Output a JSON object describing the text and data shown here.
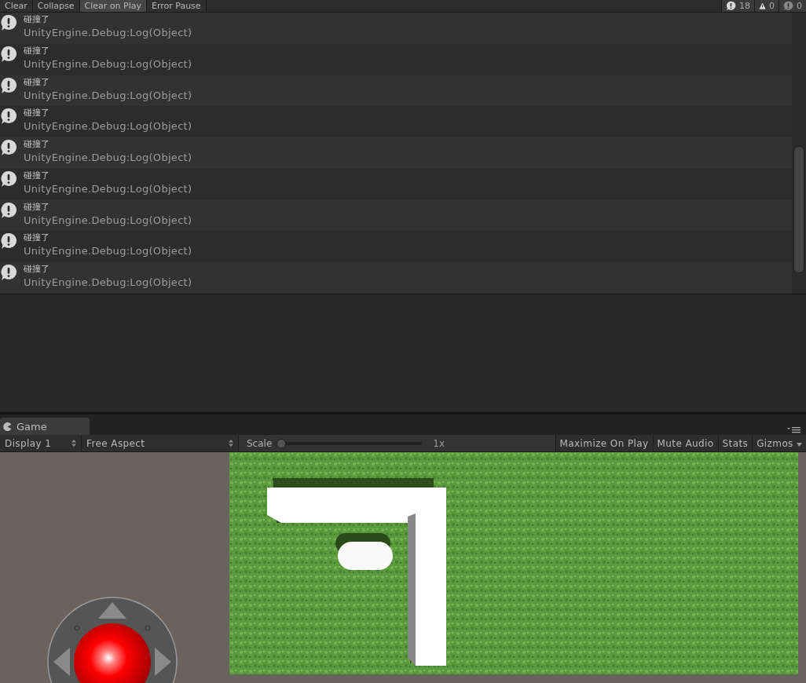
{
  "console": {
    "toolbar": [
      {
        "label": "Clear",
        "selected": false
      },
      {
        "label": "Collapse",
        "selected": false
      },
      {
        "label": "Clear on Play",
        "selected": true
      },
      {
        "label": "Error Pause",
        "selected": false
      }
    ],
    "counters": [
      {
        "kind": "info",
        "count": "18"
      },
      {
        "kind": "warning",
        "count": "0"
      },
      {
        "kind": "error",
        "count": "0"
      }
    ],
    "entries": [
      {
        "kind": "info",
        "message": "碰撞了",
        "detail": "UnityEngine.Debug:Log(Object)"
      },
      {
        "kind": "info",
        "message": "碰撞了",
        "detail": "UnityEngine.Debug:Log(Object)"
      },
      {
        "kind": "info",
        "message": "碰撞了",
        "detail": "UnityEngine.Debug:Log(Object)"
      },
      {
        "kind": "info",
        "message": "碰撞了",
        "detail": "UnityEngine.Debug:Log(Object)"
      },
      {
        "kind": "info",
        "message": "碰撞了",
        "detail": "UnityEngine.Debug:Log(Object)"
      },
      {
        "kind": "info",
        "message": "碰撞了",
        "detail": "UnityEngine.Debug:Log(Object)"
      },
      {
        "kind": "info",
        "message": "碰撞了",
        "detail": "UnityEngine.Debug:Log(Object)"
      },
      {
        "kind": "info",
        "message": "碰撞了",
        "detail": "UnityEngine.Debug:Log(Object)"
      },
      {
        "kind": "info",
        "message": "碰撞了",
        "detail": "UnityEngine.Debug:Log(Object)"
      }
    ]
  },
  "game": {
    "tab": {
      "label": "Game",
      "selected": true
    },
    "display": "Display 1",
    "aspect": "Free Aspect",
    "scale": {
      "label": "Scale",
      "level": 0,
      "reading": "1x"
    },
    "toggles": [
      {
        "label": "Maximize On Play",
        "selected": false
      },
      {
        "label": "Mute Audio",
        "selected": false
      },
      {
        "label": "Stats",
        "selected": false
      }
    ],
    "gizmos": "Gizmos"
  }
}
